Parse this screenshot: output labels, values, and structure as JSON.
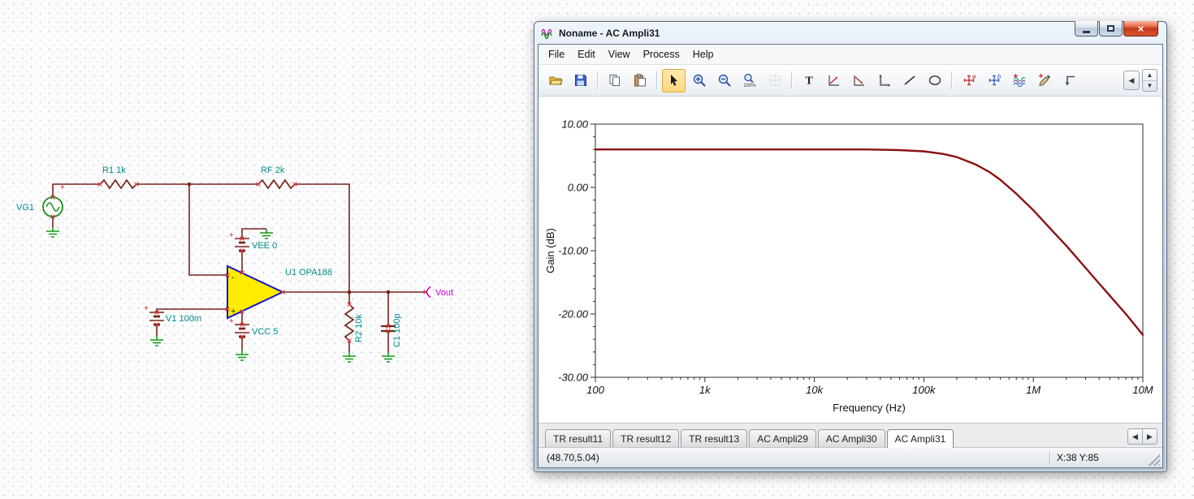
{
  "window": {
    "title": "Noname - AC Ampli31",
    "close_glyph": "×"
  },
  "menu": {
    "items": [
      "File",
      "Edit",
      "View",
      "Process",
      "Help"
    ]
  },
  "toolbar": {
    "buttons": [
      "open",
      "save",
      "copy",
      "paste",
      "select-arrow",
      "zoom-in",
      "zoom-out",
      "zoom-100",
      "grid",
      "text",
      "draw-tool-1",
      "draw-tool-2",
      "axis-settings",
      "line",
      "ellipse",
      "a-marker",
      "b-marker",
      "add-curve",
      "pen",
      "corner-arrow",
      "scroll-left",
      "spin-up",
      "spin-down"
    ],
    "selected": "select-arrow",
    "text_glyph": "T",
    "zoom100_label": "100%",
    "marker_a_label": "a",
    "marker_b_label": "b",
    "scroll_left_glyph": "◀",
    "spin_up_glyph": "▲",
    "spin_down_glyph": "▼"
  },
  "chart_data": {
    "type": "line",
    "title": "",
    "xlabel": "Frequency (Hz)",
    "ylabel": "Gain (dB)",
    "x_scale": "log",
    "grid": false,
    "x_range": [
      100,
      10000000
    ],
    "y_range": [
      -30,
      10
    ],
    "y_minor_step": 2,
    "x_ticks": [
      {
        "label": "100",
        "value": 100
      },
      {
        "label": "1k",
        "value": 1000
      },
      {
        "label": "10k",
        "value": 10000
      },
      {
        "label": "100k",
        "value": 100000
      },
      {
        "label": "1M",
        "value": 1000000
      },
      {
        "label": "10M",
        "value": 10000000
      }
    ],
    "y_ticks": [
      {
        "label": "10.00",
        "value": 10
      },
      {
        "label": "0.00",
        "value": 0
      },
      {
        "label": "-10.00",
        "value": -10
      },
      {
        "label": "-20.00",
        "value": -20
      },
      {
        "label": "-30.00",
        "value": -30
      }
    ],
    "series": [
      {
        "name": "Gain",
        "color": "#8b1212",
        "points": [
          [
            100,
            6.0
          ],
          [
            300,
            6.0
          ],
          [
            1000,
            6.0
          ],
          [
            3000,
            6.0
          ],
          [
            10000,
            6.0
          ],
          [
            30000,
            6.0
          ],
          [
            60000,
            5.9
          ],
          [
            100000,
            5.7
          ],
          [
            150000,
            5.3
          ],
          [
            200000,
            4.8
          ],
          [
            300000,
            3.6
          ],
          [
            400000,
            2.4
          ],
          [
            500000,
            1.2
          ],
          [
            700000,
            -1.0
          ],
          [
            1000000,
            -3.6
          ],
          [
            1500000,
            -6.9
          ],
          [
            2000000,
            -9.2
          ],
          [
            3000000,
            -12.7
          ],
          [
            4000000,
            -15.2
          ],
          [
            5000000,
            -17.1
          ],
          [
            7000000,
            -20.0
          ],
          [
            10000000,
            -23.3
          ]
        ]
      }
    ]
  },
  "tabs": {
    "items": [
      "TR result11",
      "TR result12",
      "TR result13",
      "AC Ampli29",
      "AC Ampli30",
      "AC Ampli31"
    ],
    "active": "AC Ampli31",
    "active_index": 5
  },
  "status": {
    "coords": "(48.70,5.04)",
    "cursor": "X:38 Y:85"
  },
  "schematic": {
    "vg1": "VG1",
    "r1": "R1 1k",
    "rf": "RF 2k",
    "vee": "VEE 0",
    "u1": "U1 OPA188",
    "v1": "V1 100m",
    "vcc": "VCC 5",
    "r2": "R2 10k",
    "c1": "C1 100p",
    "vout": "Vout",
    "plus": "+",
    "minus": "-"
  }
}
